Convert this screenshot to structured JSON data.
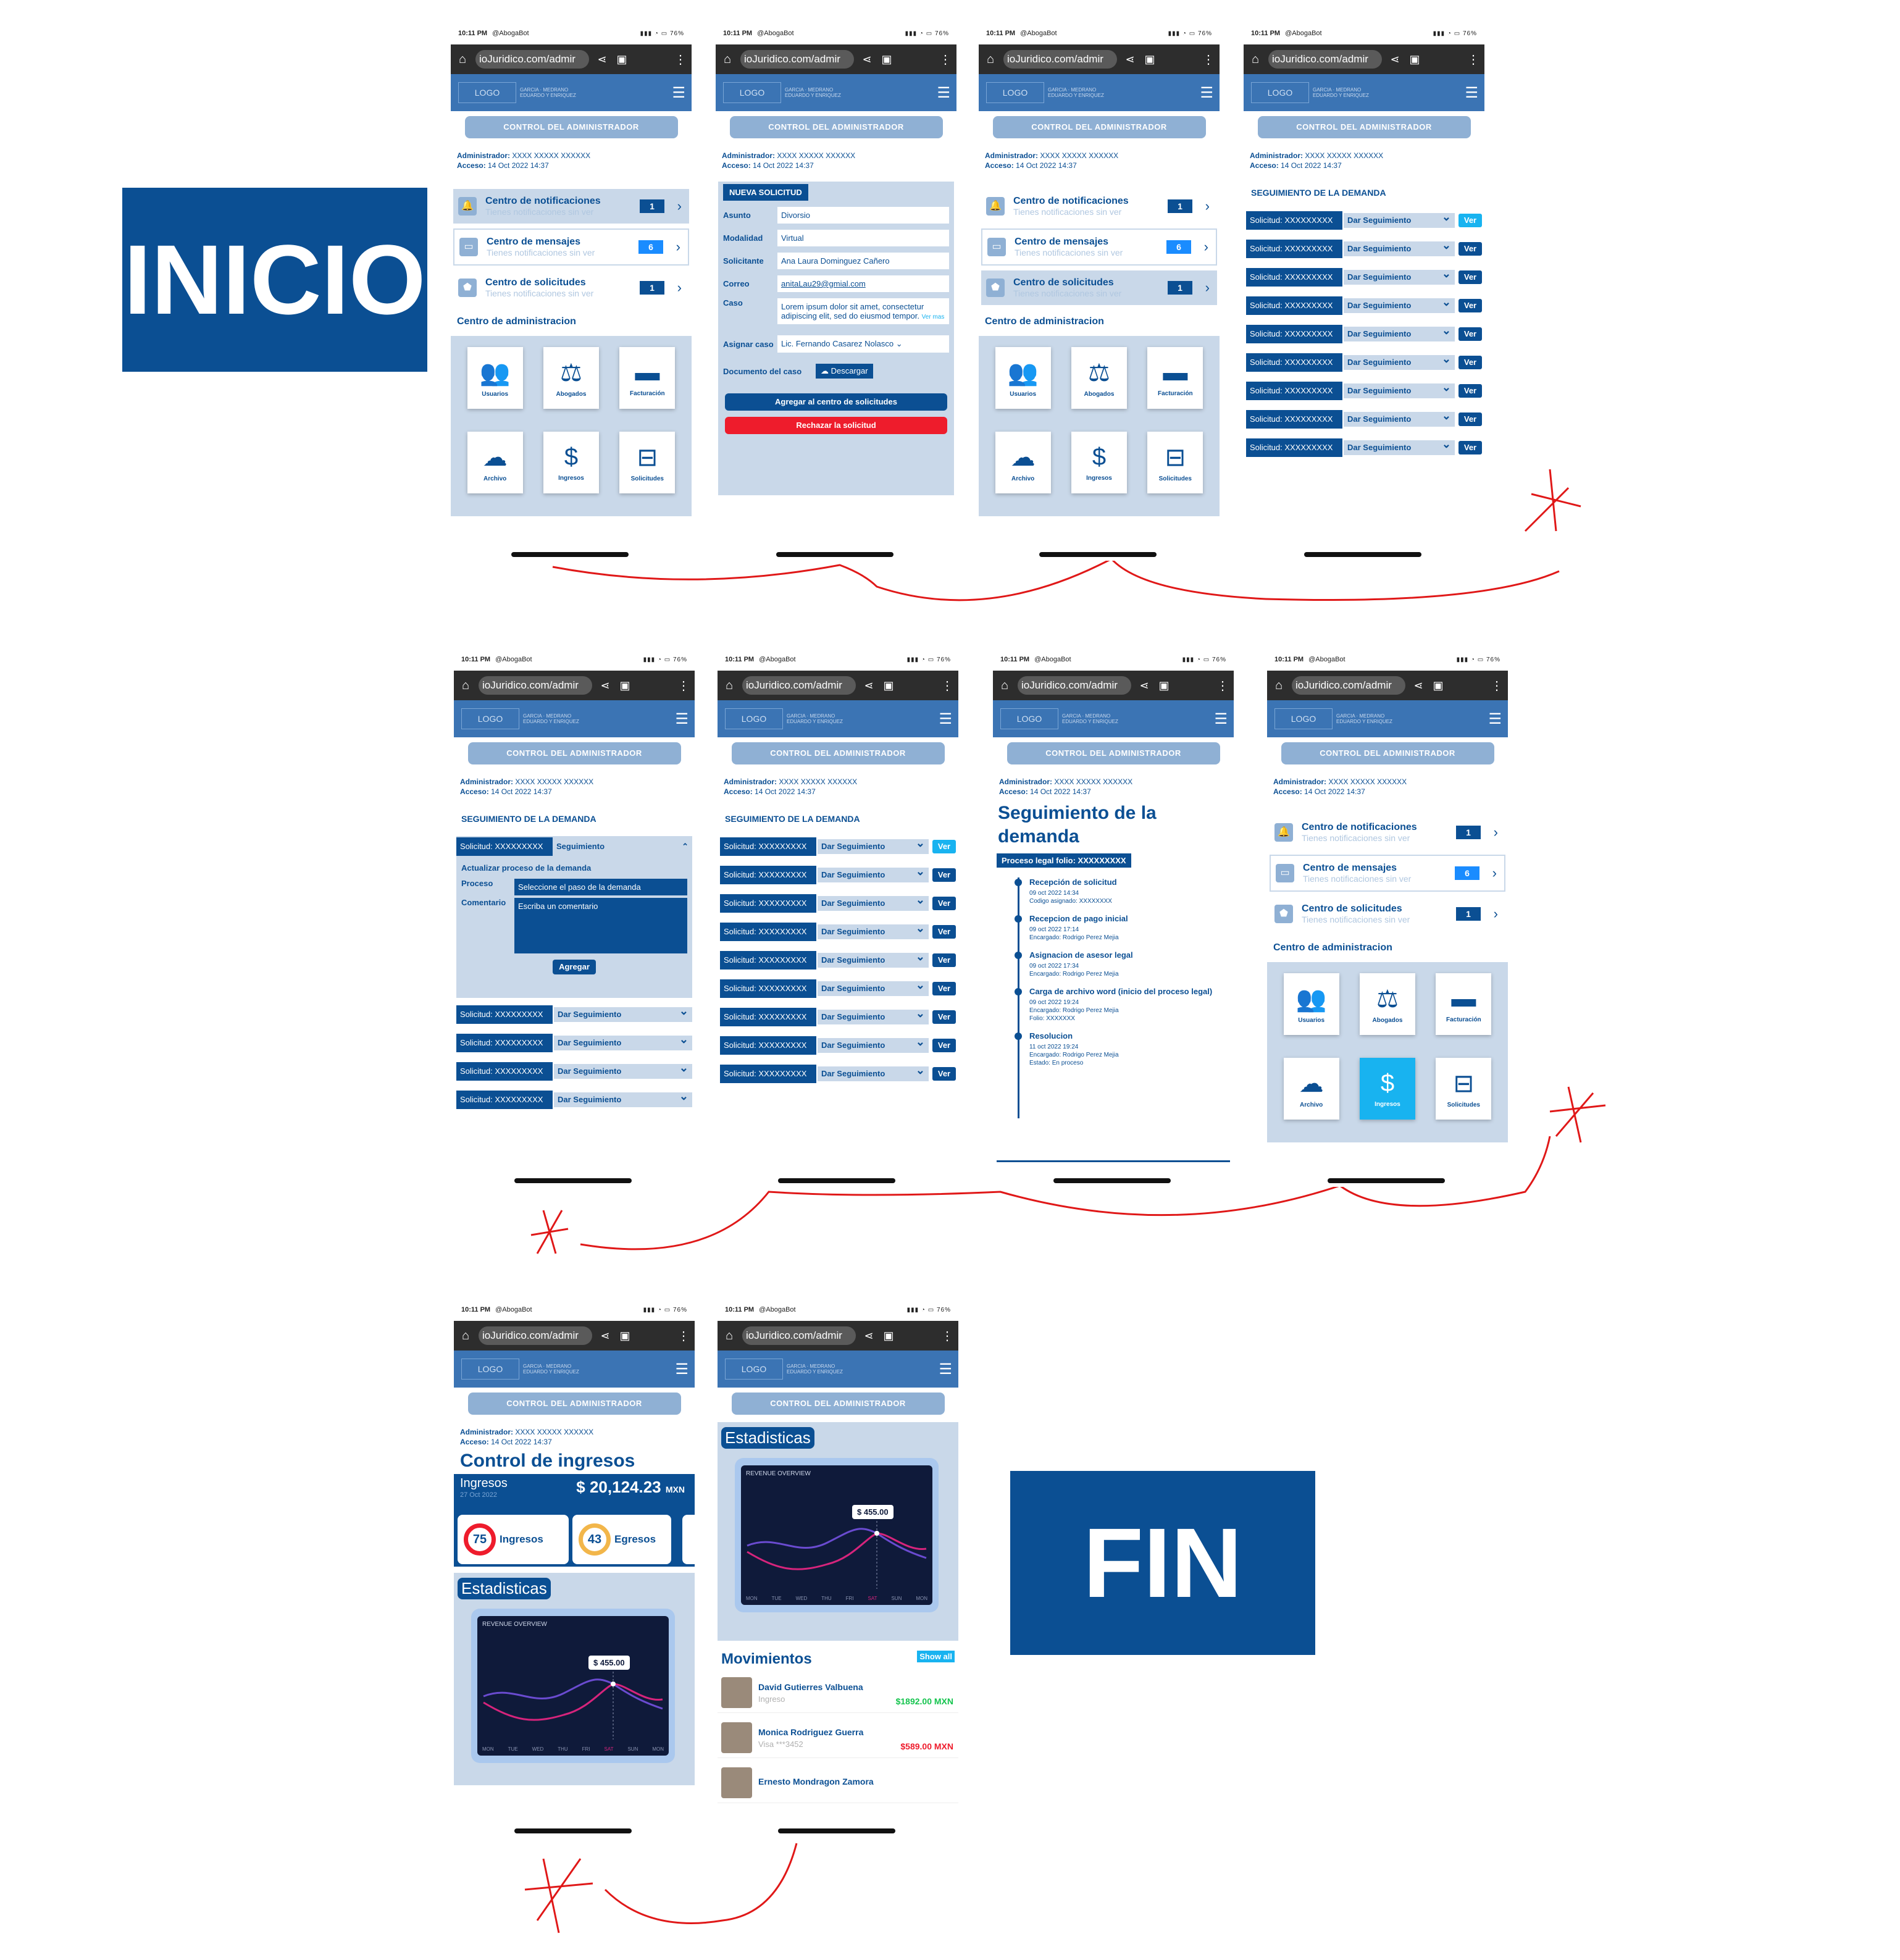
{
  "labels": {
    "start": "INICIO",
    "end": "FIN"
  },
  "common": {
    "time": "10:11 PM",
    "user": "@AbogaBot",
    "signal": "76%",
    "url": "ioJuridico.com/admir",
    "logo": "LOGO",
    "brand": "GARCIA · MEDRANO EDUARDO Y ENRIQUEZ",
    "control": "CONTROL DEL ADMINISTRADOR",
    "admin_label": "Administrador:",
    "admin_value": "XXXX XXXXX XXXXXX",
    "access_label": "Acceso:",
    "access_value": "14 Oct 2022 14:37"
  },
  "dashboard": {
    "notifications": [
      {
        "title": "Centro de notificaciones",
        "sub": "Tienes notificaciones sin ver",
        "count": "1"
      },
      {
        "title": "Centro de mensajes",
        "sub": "Tienes notificaciones sin ver",
        "count": "6"
      },
      {
        "title": "Centro de solicitudes",
        "sub": "Tienes notificaciones sin ver",
        "count": "1"
      }
    ],
    "admin_center": "Centro de administracion",
    "tiles": [
      "Usuarios",
      "Abogados",
      "Facturación",
      "Archivo",
      "Ingresos",
      "Solicitudes"
    ]
  },
  "request": {
    "header": "NUEVA SOLICITUD",
    "fields": [
      {
        "label": "Asunto",
        "value": "Divorsio"
      },
      {
        "label": "Modalidad",
        "value": "Virtual"
      },
      {
        "label": "Solicitante",
        "value": "Ana Laura Dominguez Cañero"
      },
      {
        "label": "Correo",
        "value": "anitaLau29@gmial.com"
      },
      {
        "label": "Caso",
        "value": "Lorem ipsum dolor sit amet, consectetur adipiscing elit, sed do eiusmod tempor."
      }
    ],
    "ver_mas": "Ver mas",
    "assign_label": "Asignar caso",
    "assign_value": "Lic. Fernando Casarez Nolasco",
    "doc_label": "Documento del caso",
    "download": "Descargar",
    "add_btn": "Agregar al centro de solicitudes",
    "reject_btn": "Rechazar la solicitud"
  },
  "tracking": {
    "title": "SEGUIMIENTO DE LA DEMANDA",
    "row_label": "Solicitud:",
    "row_value": "XXXXXXXXX",
    "row_action": "Dar Seguimiento",
    "view": "Ver",
    "expanded_action": "Seguimiento",
    "update_title": "Actualizar proceso de la demanda",
    "process_label": "Proceso",
    "process_value": "Seleccione el paso de la demanda",
    "comment_label": "Comentario",
    "comment_placeholder": "Escriba un comentario",
    "add": "Agregar"
  },
  "timeline": {
    "title": "Seguimiento de la demanda",
    "folio": "Proceso legal folio: XXXXXXXXX",
    "items": [
      {
        "title": "Recepción de solicitud",
        "l1": "09 oct 2022 14:34",
        "l2": "Codigo asignado: XXXXXXXX",
        "l3": ""
      },
      {
        "title": "Recepcion de pago inicial",
        "l1": "09 oct 2022 17:14",
        "l2": "Encargado: Rodrigo Perez Mejia",
        "l3": ""
      },
      {
        "title": "Asignacion de asesor legal",
        "l1": "09 oct 2022 17:34",
        "l2": "Encargado: Rodrigo Perez Mejia",
        "l3": ""
      },
      {
        "title": "Carga de archivo word (inicio del proceso legal)",
        "l1": "09 oct 2022 19:24",
        "l2": "Encargado: Rodrigo Perez Mejia",
        "l3": "Folio: XXXXXXX"
      },
      {
        "title": "Resolucion",
        "l1": "11 oct 2022 19:24",
        "l2": "Encargado: Rodrigo Perez Mejia",
        "l3": "Estado: En proceso"
      }
    ]
  },
  "income": {
    "title": "Control de ingresos",
    "label": "Ingresos",
    "date": "27 Oct 2022",
    "amount": "$ 20,124.23",
    "currency": "MXN",
    "kpis": [
      {
        "value": "75",
        "label": "Ingresos"
      },
      {
        "value": "43",
        "label": "Egresos"
      }
    ],
    "stats": "Estadisticas",
    "chart_title": "REVENUE OVERVIEW",
    "chart_tip": "$ 455.00",
    "days": [
      "MON",
      "TUE",
      "WED",
      "THU",
      "FRI",
      "SAT",
      "SUN",
      "MON"
    ]
  },
  "movements": {
    "title": "Movimientos",
    "show_all": "Show all",
    "items": [
      {
        "name": "David Gutierres Valbuena",
        "type": "Ingreso",
        "amount": "$1892.00 MXN"
      },
      {
        "name": "Monica Rodriguez Guerra",
        "type": "Visa ***3452",
        "amount": "$589.00 MXN"
      },
      {
        "name": "Ernesto Mondragon Zamora",
        "type": "",
        "amount": ""
      }
    ]
  }
}
